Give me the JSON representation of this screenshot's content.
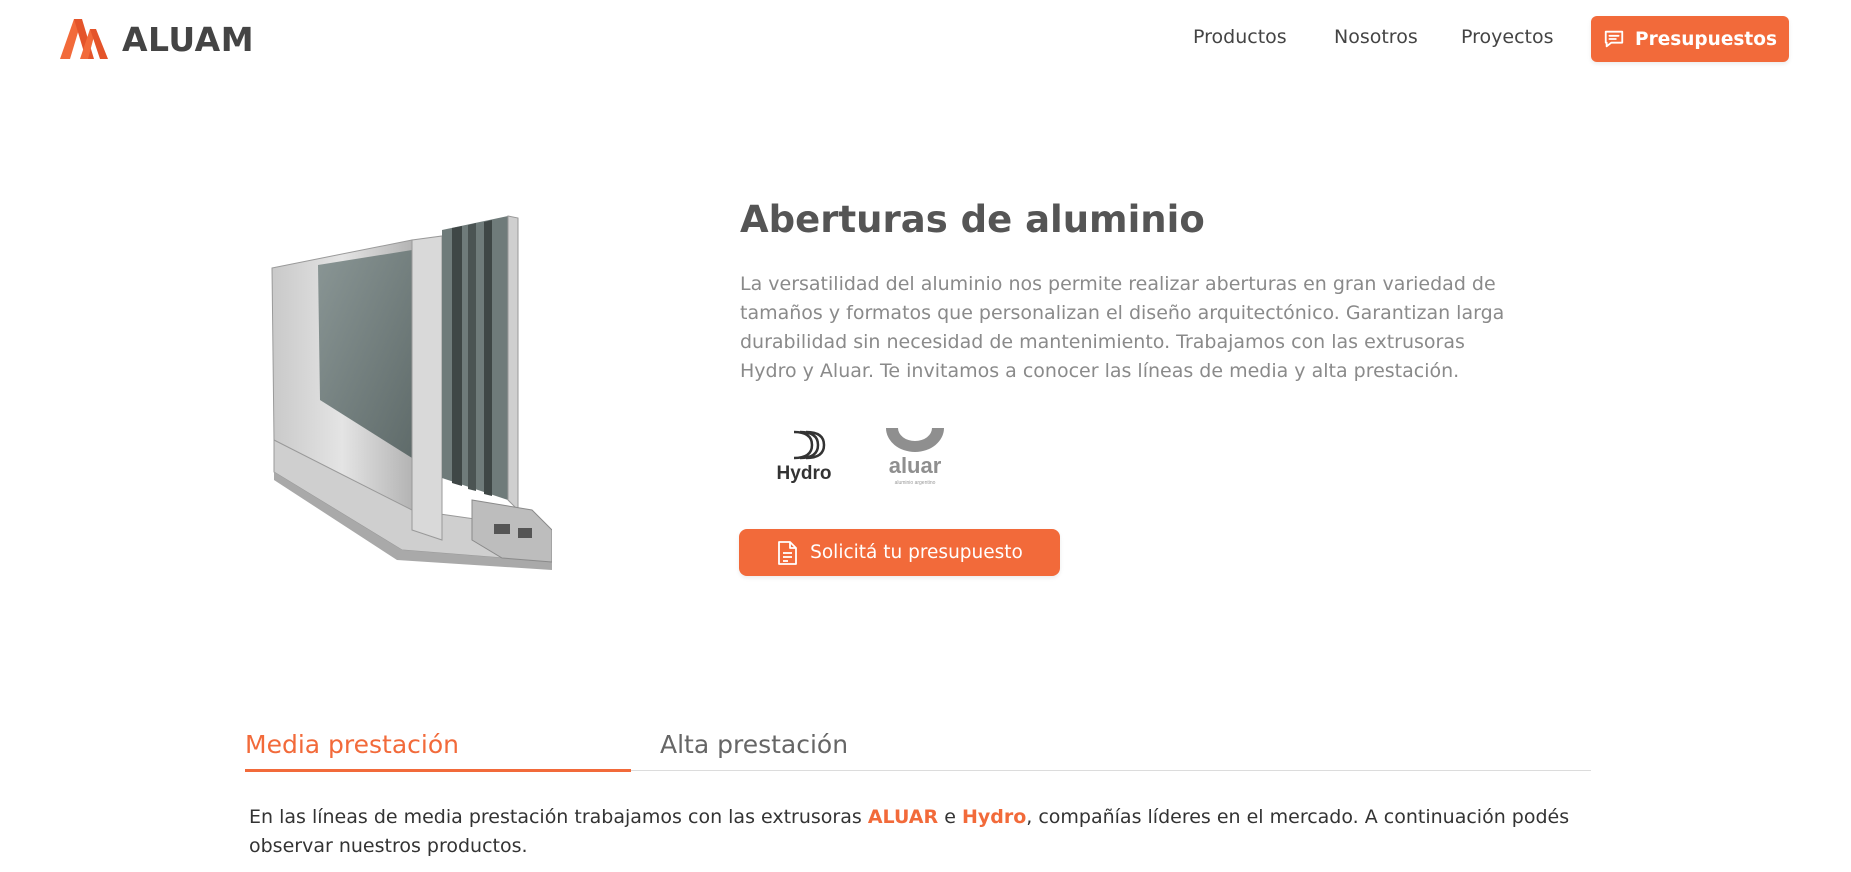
{
  "brand": {
    "name": "ALUAM",
    "accent_color": "#f26a3a"
  },
  "nav": {
    "items": [
      "Productos",
      "Nosotros",
      "Proyectos"
    ],
    "cta_label": "Presupuestos",
    "cta_icon": "chat-icon"
  },
  "hero": {
    "title": "Aberturas de aluminio",
    "description": "La versatilidad del aluminio nos permite realizar aberturas en gran variedad de tamaños y formatos que personalizan el diseño arquitectónico. Garantizan larga durabilidad sin necesidad de mantenimiento. Trabajamos con las extrusoras Hydro y Aluar. Te invitamos a conocer las líneas de media y alta prestación.",
    "brand_logos": [
      {
        "name": "Hydro"
      },
      {
        "name": "aluar",
        "tagline": "aluminio argentino"
      }
    ],
    "cta_label": "Solicitá tu presupuesto",
    "cta_icon": "document-icon"
  },
  "tabs": {
    "items": [
      {
        "label": "Media prestación",
        "active": true
      },
      {
        "label": "Alta prestación",
        "active": false
      }
    ],
    "content": {
      "before": "En las líneas de media prestación trabajamos con las extrusoras ",
      "highlight1": "ALUAR",
      "between": " e ",
      "highlight2": "Hydro",
      "after": ", compañías líderes en el mercado. A continuación podés observar nuestros productos."
    }
  }
}
